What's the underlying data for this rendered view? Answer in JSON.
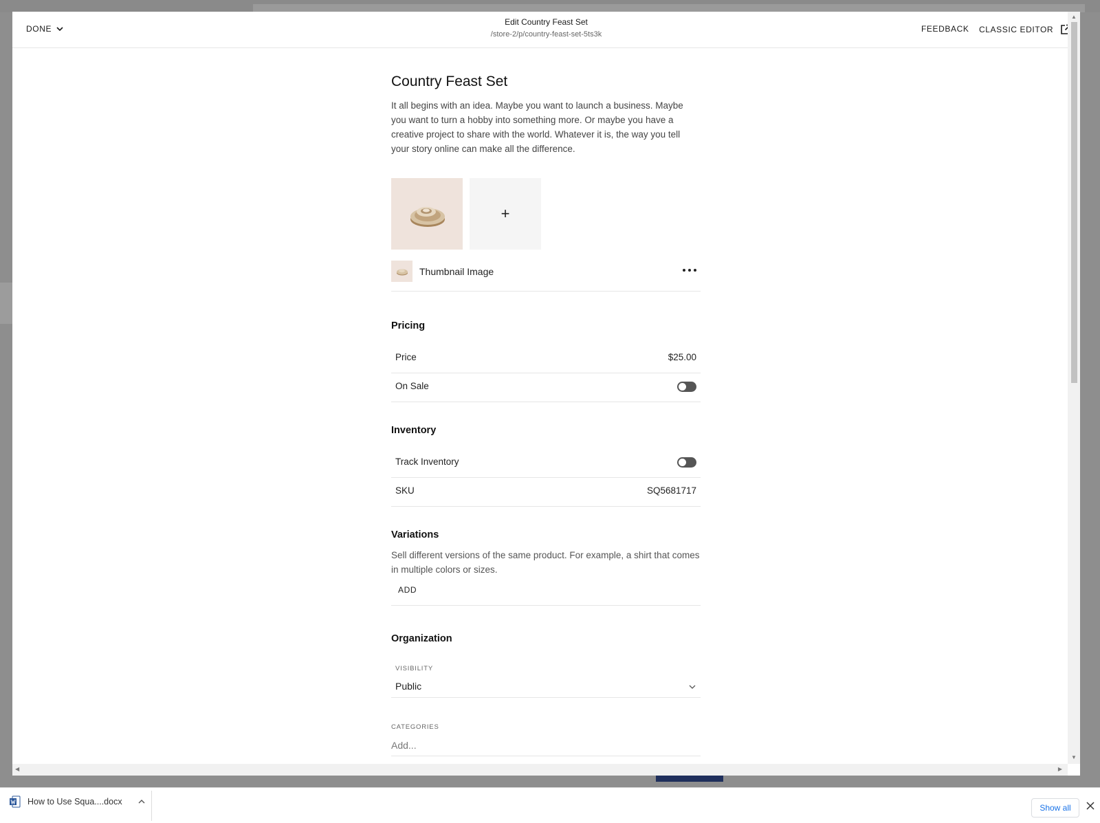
{
  "header": {
    "done_label": "DONE",
    "title": "Edit Country Feast Set",
    "url": "/store-2/p/country-feast-set-5ts3k",
    "feedback_label": "FEEDBACK",
    "classic_editor_label": "CLASSIC EDITOR"
  },
  "product": {
    "title": "Country Feast Set",
    "description": "It all begins with an idea. Maybe you want to launch a business. Maybe you want to turn a hobby into something more. Or maybe you have a creative project to share with the world. Whatever it is, the way you tell your story online can make all the difference.",
    "add_image_symbol": "+",
    "thumbnail_label": "Thumbnail Image"
  },
  "pricing": {
    "heading": "Pricing",
    "price_label": "Price",
    "price_value": "$25.00",
    "on_sale_label": "On Sale",
    "on_sale_enabled": false
  },
  "inventory": {
    "heading": "Inventory",
    "track_label": "Track Inventory",
    "track_enabled": false,
    "sku_label": "SKU",
    "sku_value": "SQ5681717"
  },
  "variations": {
    "heading": "Variations",
    "description": "Sell different versions of the same product. For example, a shirt that comes in multiple colors or sizes.",
    "add_label": "ADD"
  },
  "organization": {
    "heading": "Organization",
    "visibility_label": "VISIBILITY",
    "visibility_value": "Public",
    "categories_label": "CATEGORIES",
    "categories_placeholder": "Add..."
  },
  "download_bar": {
    "file_name": "How to Use Squa....docx",
    "show_all_label": "Show all"
  },
  "colors": {
    "accent_link": "#1a73e8",
    "product_bg": "#efe3dc",
    "toggle_off": "#555555"
  },
  "icons": [
    "chevron-down-icon",
    "external-link-icon",
    "plus-icon",
    "more-icon",
    "word-doc-icon",
    "close-icon"
  ]
}
